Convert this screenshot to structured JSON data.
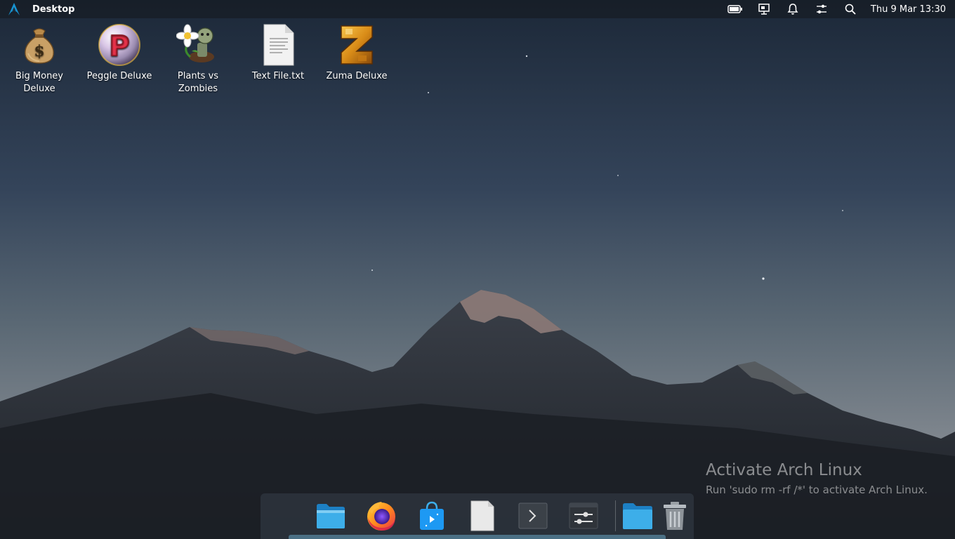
{
  "topbar": {
    "logo_icon": "arch-logo-icon",
    "title": "Desktop",
    "tray": [
      {
        "name": "battery-icon"
      },
      {
        "name": "network-display-icon"
      },
      {
        "name": "bell-icon"
      },
      {
        "name": "sliders-icon"
      },
      {
        "name": "search-icon"
      }
    ],
    "clock": "Thu 9 Mar 13:30"
  },
  "desktop": {
    "icons": [
      {
        "label": "Big Money Deluxe",
        "icon": "money-bag-icon"
      },
      {
        "label": "Peggle Deluxe",
        "icon": "peggle-icon"
      },
      {
        "label": "Plants vs Zombies",
        "icon": "plants-vs-zombies-icon"
      },
      {
        "label": "Text File.txt",
        "icon": "text-file-icon"
      },
      {
        "label": "Zuma Deluxe",
        "icon": "zuma-icon"
      }
    ]
  },
  "watermark": {
    "title": "Activate Arch Linux",
    "subtitle": "Run 'sudo rm -rf /*' to activate Arch Linux."
  },
  "dock": {
    "items": [
      {
        "name": "files-app",
        "icon": "folder-icon"
      },
      {
        "name": "firefox",
        "icon": "firefox-icon"
      },
      {
        "name": "software-store",
        "icon": "store-bag-icon"
      },
      {
        "name": "text-editor",
        "icon": "document-icon"
      },
      {
        "name": "terminal",
        "icon": "terminal-icon"
      },
      {
        "name": "settings",
        "icon": "settings-sliders-icon"
      },
      {
        "name": "home-folder",
        "icon": "folder-icon"
      },
      {
        "name": "trash",
        "icon": "trash-icon"
      }
    ]
  },
  "colors": {
    "accent": "#1793d1",
    "folder_blue": "#3daee9"
  }
}
